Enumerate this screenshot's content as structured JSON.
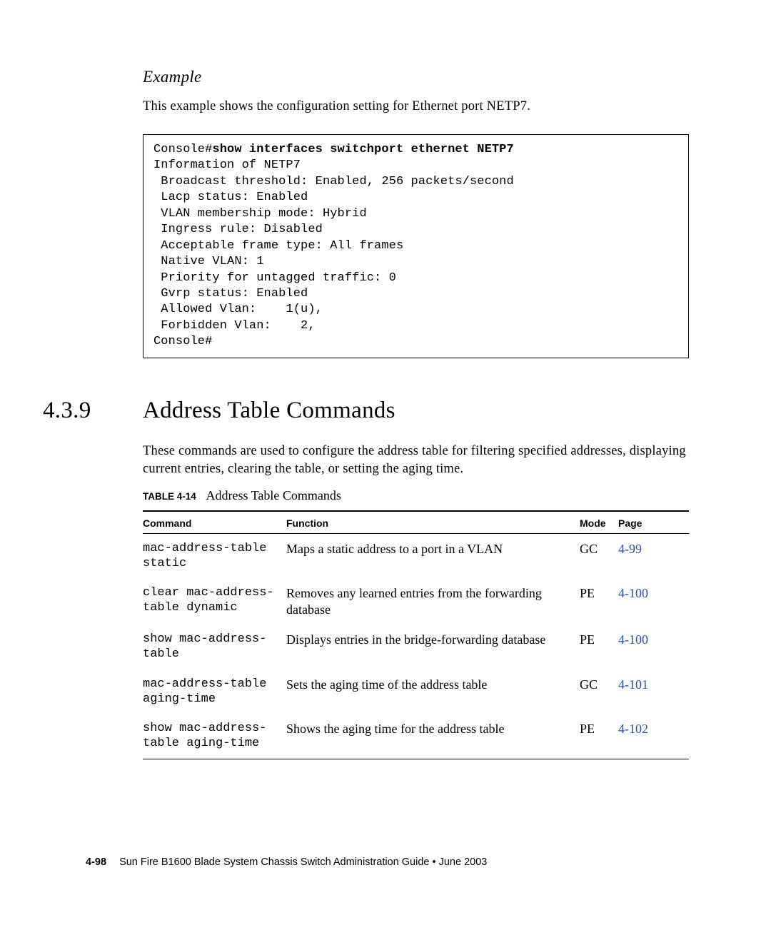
{
  "example": {
    "heading": "Example",
    "intro": "This example shows the configuration setting for Ethernet port NETP7.",
    "code_prefix": "Console#",
    "code_bold": "show interfaces switchport ethernet NETP7",
    "code_body": "Information of NETP7\n Broadcast threshold: Enabled, 256 packets/second\n Lacp status: Enabled\n VLAN membership mode: Hybrid\n Ingress rule: Disabled\n Acceptable frame type: All frames\n Native VLAN: 1\n Priority for untagged traffic: 0\n Gvrp status: Enabled\n Allowed Vlan:    1(u),\n Forbidden Vlan:    2,\nConsole#"
  },
  "section": {
    "number": "4.3.9",
    "title": "Address Table Commands",
    "intro": "These commands are used to configure the address table for filtering specified addresses, displaying current entries, clearing the table, or setting the aging time."
  },
  "table_caption": {
    "label": "TABLE 4-14",
    "title": "Address Table Commands"
  },
  "table": {
    "headers": {
      "command": "Command",
      "function": "Function",
      "mode": "Mode",
      "page": "Page"
    },
    "rows": [
      {
        "command": "mac-address-table static",
        "function": "Maps a static address to a port in a VLAN",
        "mode": "GC",
        "page": "4-99"
      },
      {
        "command": "clear mac-address-table dynamic",
        "function": "Removes any learned entries from the forwarding database",
        "mode": "PE",
        "page": "4-100"
      },
      {
        "command": "show mac-address-table",
        "function": "Displays entries in the bridge-forwarding database",
        "mode": "PE",
        "page": "4-100"
      },
      {
        "command": "mac-address-table aging-time",
        "function": "Sets the aging time of the address table",
        "mode": "GC",
        "page": "4-101"
      },
      {
        "command": "show mac-address-table aging-time",
        "function": "Shows the aging time for the address table",
        "mode": "PE",
        "page": "4-102"
      }
    ]
  },
  "footer": {
    "page_number": "4-98",
    "doc_title": "Sun Fire B1600 Blade System Chassis Switch Administration Guide • June 2003"
  }
}
